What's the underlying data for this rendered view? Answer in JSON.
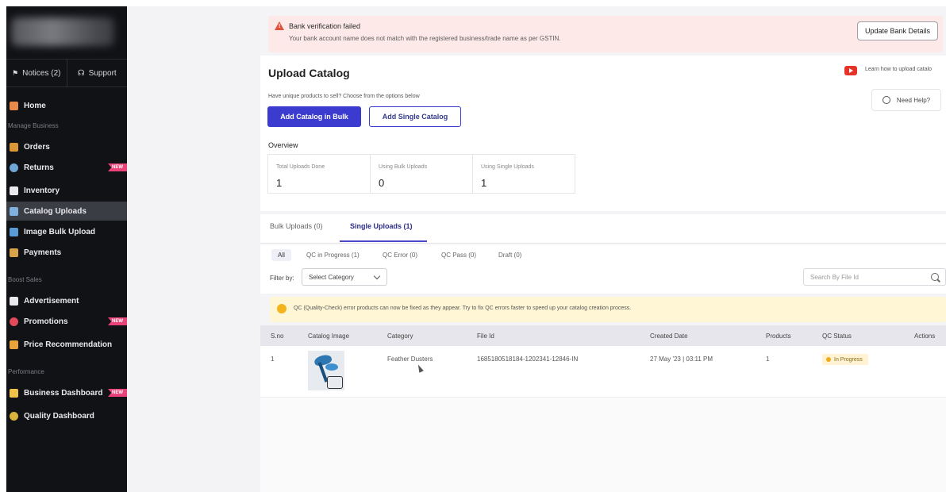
{
  "sidebar": {
    "notices_label": "Notices (2)",
    "support_label": "Support",
    "home": "Home",
    "section_manage": "Manage Business",
    "items_manage": [
      {
        "label": "Orders",
        "badge": ""
      },
      {
        "label": "Returns",
        "badge": "NEW"
      },
      {
        "label": "Inventory",
        "badge": ""
      },
      {
        "label": "Catalog Uploads",
        "badge": ""
      },
      {
        "label": "Image Bulk Upload",
        "badge": ""
      },
      {
        "label": "Payments",
        "badge": ""
      }
    ],
    "section_boost": "Boost Sales",
    "items_boost": [
      {
        "label": "Advertisement",
        "badge": ""
      },
      {
        "label": "Promotions",
        "badge": "NEW"
      },
      {
        "label": "Price Recommendation",
        "badge": ""
      }
    ],
    "section_performance": "Performance",
    "items_performance": [
      {
        "label": "Business Dashboard",
        "badge": "NEW"
      },
      {
        "label": "Quality Dashboard",
        "badge": ""
      }
    ],
    "active_item": "Catalog Uploads"
  },
  "banner": {
    "title": "Bank verification failed",
    "message": "Your bank account name does not match with the registered business/trade name as per GSTIN.",
    "button": "Update Bank Details"
  },
  "upload": {
    "title": "Upload Catalog",
    "learn_link": "Learn how to upload catalo",
    "help": "Need Help?",
    "subtitle": "Have unique products to sell? Choose from the options below",
    "bulk_button": "Add Catalog in Bulk",
    "single_button": "Add Single Catalog",
    "overview_label": "Overview",
    "stats": [
      {
        "label": "Total Uploads Done",
        "value": "1"
      },
      {
        "label": "Using Bulk Uploads",
        "value": "0"
      },
      {
        "label": "Using Single Uploads",
        "value": "1"
      }
    ]
  },
  "tabs": {
    "bulk": "Bulk Uploads (0)",
    "single": "Single Uploads (1)"
  },
  "subtabs": {
    "all": "All",
    "qc_progress": "QC in Progress (1)",
    "qc_error": "QC Error (0)",
    "qc_pass": "QC Pass (0)",
    "draft": "Draft (0)"
  },
  "filter": {
    "label": "Filter by:",
    "select_value": "Select Category",
    "search_placeholder": "Search By File Id"
  },
  "notice": "QC (Quality-Check) error products can now be fixed as they appear. Try to fix QC errors faster to speed up your catalog creation process.",
  "table": {
    "headers": {
      "sno": "S.no",
      "image": "Catalog Image",
      "category": "Category",
      "file_id": "File Id",
      "created": "Created Date",
      "products": "Products",
      "qc": "QC Status",
      "actions": "Actions"
    },
    "rows": [
      {
        "sno": "1",
        "category": "Feather Dusters",
        "file_id": "1685180518184-1202341-12846-IN",
        "created": "27 May '23 | 03:11 PM",
        "products": "1",
        "qc": "In Progress"
      }
    ]
  },
  "colors": {
    "primary": "#3c3bd0",
    "sidebar_bg": "#111216",
    "new_badge": "#e9437a",
    "warning": "#e0533d",
    "in_progress": "#f0ad1a"
  }
}
